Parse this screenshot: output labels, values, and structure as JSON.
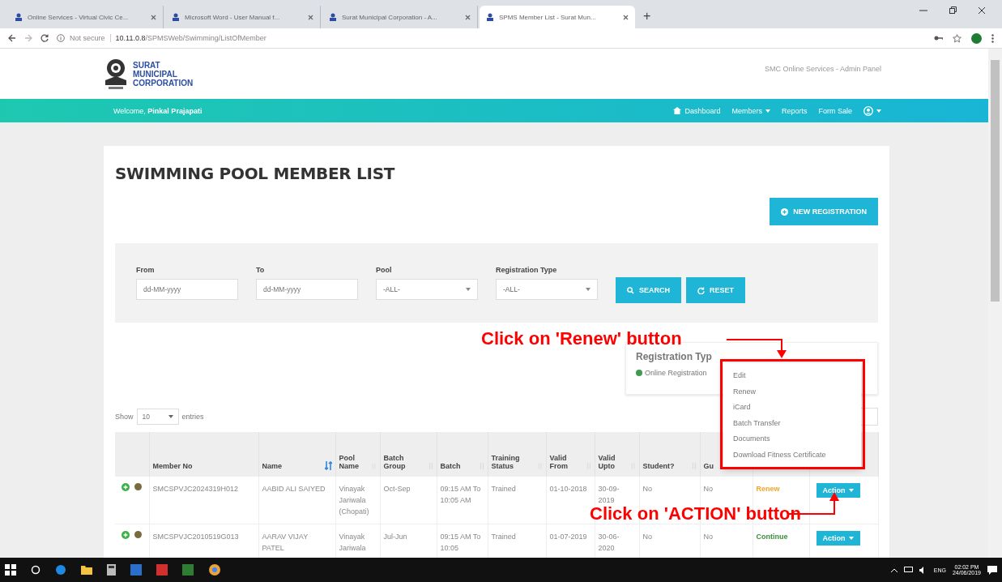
{
  "browser": {
    "tabs": [
      {
        "title": "Online Services - Virtual Civic Ce...",
        "selected": false
      },
      {
        "title": "Microsoft Word - User Manual f...",
        "selected": false
      },
      {
        "title": "Surat Municipal Corporation - A...",
        "selected": false
      },
      {
        "title": "SPMS Member List - Surat Mun...",
        "selected": true
      }
    ],
    "new_tab": "+",
    "security": "Not secure",
    "url_host": "10.11.0.8",
    "url_path": "/SPMSWeb/Swimming/ListOfMember"
  },
  "header": {
    "logo_lines": [
      "SURAT",
      "MUNICIPAL",
      "CORPORATION"
    ],
    "panel_title": "SMC Online Services - Admin Panel"
  },
  "navbar": {
    "welcome": "Welcome, **Pinkal Prajapati**",
    "items": [
      {
        "kind": "icon-link",
        "label": "Dashboard"
      },
      {
        "kind": "dropdown",
        "label": "Members"
      },
      {
        "kind": "link",
        "label": "Reports"
      },
      {
        "kind": "link",
        "label": "Form Sale"
      },
      {
        "kind": "user-menu"
      }
    ]
  },
  "page": {
    "title": "SWIMMING POOL MEMBER LIST",
    "new_button": "NEW REGISTRATION"
  },
  "filters": {
    "fields": [
      {
        "kind": "date",
        "label": "From",
        "placeholder": "dd-MM-yyyy"
      },
      {
        "kind": "date",
        "label": "To",
        "placeholder": "dd-MM-yyyy"
      },
      {
        "kind": "select",
        "label": "Pool",
        "value": "-ALL-"
      },
      {
        "kind": "select",
        "label": "Registration Type",
        "value": "-ALL-"
      }
    ],
    "buttons": [
      {
        "kind": "search",
        "label": "SEARCH"
      },
      {
        "kind": "reset",
        "label": "RESET"
      }
    ]
  },
  "legend": {
    "title": "Registration Typ",
    "items": [
      {
        "label": "Online Registration",
        "color": "#3e9b4f"
      }
    ]
  },
  "length_menu": {
    "show": "Show",
    "value": "10",
    "entries": "entries"
  },
  "table": {
    "columns": [
      {
        "label": "Member No"
      },
      {
        "label": "Name",
        "sorted": true
      },
      {
        "label": "Pool Name",
        "sorted": false
      },
      {
        "label": "Batch Group",
        "sorted": false
      },
      {
        "label": "Batch",
        "sorted": false
      },
      {
        "label": "Training Status",
        "sorted": false
      },
      {
        "label": "Valid From",
        "sorted": false
      },
      {
        "label": "Valid Upto",
        "sorted": false
      },
      {
        "label": "Student?",
        "sorted": false
      },
      {
        "label": "Gu"
      }
    ],
    "rows": [
      {
        "cells": [
          "SMCSPVJC2024319H012",
          "AABID ALI SAIYED",
          "Vinayak Jariwala (Chopati)",
          "Oct-Sep",
          "09:15 AM To 10:05 AM",
          "Trained",
          "01-10-2018",
          "30-09-2019",
          "No",
          "No"
        ],
        "status": "Renew",
        "color": "#f0a830",
        "action": "Action"
      },
      {
        "cells": [
          "SMCSPVJC2010519G013",
          "AARAV VIJAY PATEL",
          "Vinayak Jariwala",
          "Jul-Jun",
          "09:15 AM To 10:05",
          "Trained",
          "01-07-2019",
          "30-06-2020",
          "No",
          "No"
        ],
        "status": "Continue",
        "color": "#3c8d3c",
        "action": "Action"
      }
    ]
  },
  "action_menu": {
    "items": [
      "Edit",
      "Renew",
      "iCard",
      "Batch Transfer",
      "Documents",
      "Download Fitness Certificate"
    ]
  },
  "annotations": [
    {
      "kind": "renew",
      "text": "Click on 'Renew' button"
    },
    {
      "kind": "action",
      "text": "Click on 'ACTION' button"
    }
  ],
  "taskbar": {
    "language": "ENG",
    "time": "02:02 PM",
    "date": "24/06/2019"
  }
}
